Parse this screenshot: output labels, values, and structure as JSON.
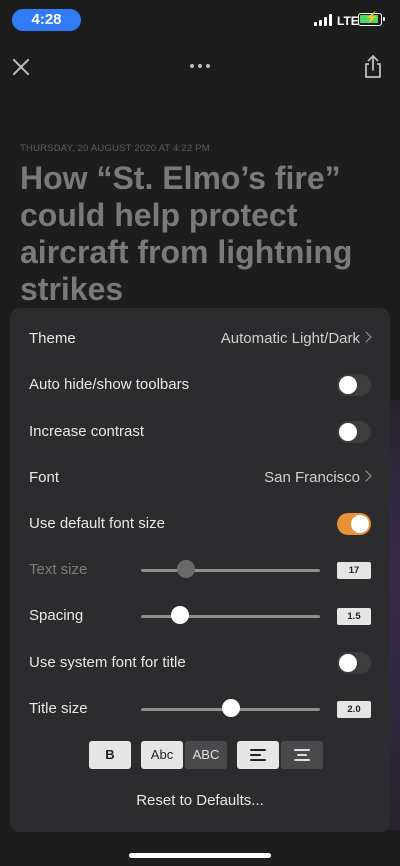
{
  "status_bar": {
    "time": "4:28",
    "network": "LTE"
  },
  "article": {
    "date": "THURSDAY, 20 AUGUST 2020 AT 4:22 PM",
    "title": "How “St. Elmo’s fire” could help protect aircraft from lightning strikes"
  },
  "settings": {
    "theme": {
      "label": "Theme",
      "value": "Automatic Light/Dark"
    },
    "auto_hide": {
      "label": "Auto hide/show toolbars",
      "on": false
    },
    "increase_contrast": {
      "label": "Increase contrast",
      "on": false
    },
    "font": {
      "label": "Font",
      "value": "San Francisco"
    },
    "default_font_size": {
      "label": "Use default font size",
      "on": true
    },
    "text_size": {
      "label": "Text size",
      "value": "17",
      "fraction": 0.25
    },
    "spacing": {
      "label": "Spacing",
      "value": "1.5",
      "fraction": 0.22
    },
    "system_font_title": {
      "label": "Use system font for title",
      "on": false
    },
    "title_size": {
      "label": "Title size",
      "value": "2.0",
      "fraction": 0.5
    },
    "style_buttons": {
      "bold": "B",
      "title_case": "Abc",
      "upper_case": "ABC"
    },
    "reset_label": "Reset to Defaults..."
  },
  "colors": {
    "accent_toggle": "#e89235",
    "time_pill": "#2f7cf6"
  }
}
